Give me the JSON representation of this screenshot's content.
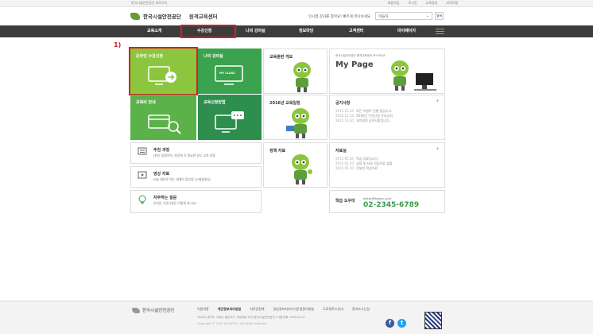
{
  "util": {
    "left_text": "한국시설안전공단 바로가기",
    "links": [
      "회원가입",
      "로그인",
      "교육일정",
      "사이트맵"
    ]
  },
  "header": {
    "brand": "한국시설안전공단",
    "center": "원격교육센터",
    "search_message": "인시험 강사를 찾아요! 빠르게 만나보세요.",
    "select_value": "학습자",
    "search_button": "검색"
  },
  "nav": {
    "items": [
      "교육소개",
      "수강신청",
      "나의 강의실",
      "정보마당",
      "고객센터",
      "마이페이지"
    ]
  },
  "annotation": "1)",
  "tiles": {
    "online": "온라인 수강신청",
    "myclass": "나의 강의실",
    "myclass_badge": "MY CLASS",
    "guide": "교육비 안내",
    "method": "교육신청방법"
  },
  "panels": {
    "intro": "교육훈련 개요",
    "mypage_sub": "한국시설안전공단 원격교육센터 MY PAGE",
    "mypage_title": "My Page",
    "schedule": "2016년 교육일정",
    "notice": {
      "title": "공지사항",
      "items": [
        {
          "date": "2015.12.20",
          "text": "모든 이벤트 진행 중입니다."
        },
        {
          "date": "2015.12.14",
          "text": "2016년 수강신청 안내공지"
        },
        {
          "date": "2015.11.30",
          "text": "교육일정 공지사항입니다."
        }
      ]
    },
    "policy": "정책 자료",
    "archive": {
      "title": "자료실",
      "items": [
        {
          "date": "2015.05.20",
          "text": "학습 자료입니다."
        },
        {
          "date": "2015.05.20",
          "text": "교량 및 터널 학습자료 샘플"
        },
        {
          "date": "2015.05.20",
          "text": "건설안 학습자료"
        }
      ]
    }
  },
  "list": [
    {
      "title": "추천 과정",
      "desc": "[최신 업데이트] 현장에 꼭 필요한 실무 교육 과정"
    },
    {
      "title": "영상 자료",
      "desc": "EBS 테마로 하는 세계의 명교량 (스페셜영상)"
    },
    {
      "title": "자주하는 질문",
      "desc": "온라인 수강신청은 어떻게 하나요?"
    }
  ],
  "help": {
    "title": "학습 도우미",
    "email": "kistec@kistec.or.kr",
    "phone": "02-2345-6789"
  },
  "footer": {
    "brand": "한국시설안전공단",
    "links": [
      "이용약관",
      "개인정보처리방침",
      "저작권정책",
      "영상정보처리기기운영관리방침",
      "도로명주소안내",
      "찾아오시는길"
    ],
    "address": "10223  경기도 고양시 일산서구 고양대로 315 한국시설안전공단  /  대표전화 1599-4114",
    "copyright": "Copyright © 2015 by KISTEC. All rights reserved."
  },
  "colors": {
    "nav_bg": "#3c3c3c",
    "accent_green": "#3b9b4a",
    "tile_lime": "#8cc63f",
    "highlight_red": "#d62020"
  }
}
